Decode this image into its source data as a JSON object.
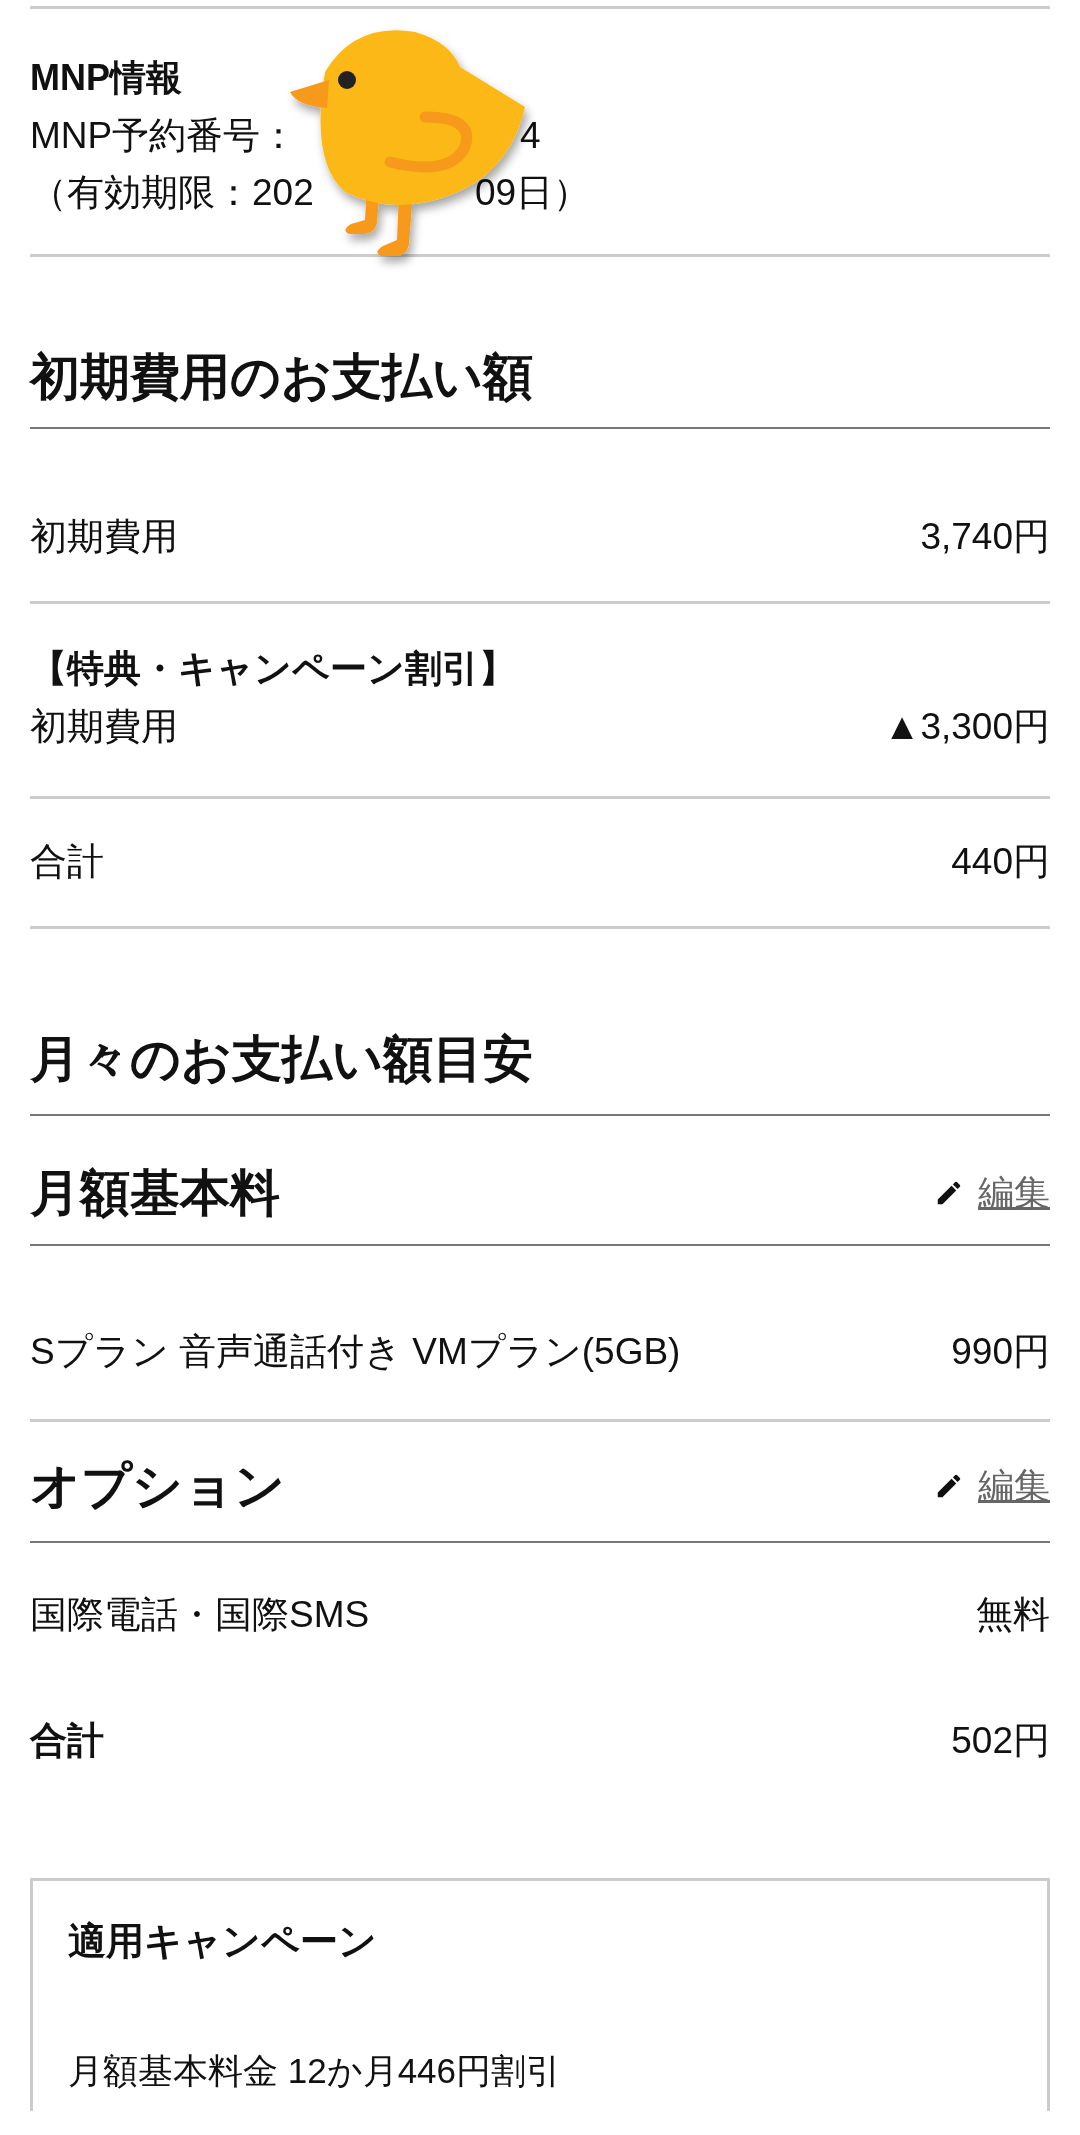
{
  "mnp": {
    "title": "MNP情報",
    "number_label": "MNP予約番号：",
    "number_tail": "4",
    "expiry_head": "（有効期限：202",
    "expiry_tail": "09日）"
  },
  "initial": {
    "title": "初期費用のお支払い額",
    "rows": [
      {
        "kind": "row",
        "label": "初期費用",
        "amount": "3,740円"
      },
      {
        "kind": "discount",
        "note": "【特典・キャンペーン割引】",
        "label": "初期費用",
        "amount": "▲3,300円"
      },
      {
        "kind": "row",
        "label": "合計",
        "amount": "440円"
      }
    ]
  },
  "monthly": {
    "title": "月々のお支払い額目安",
    "groups": [
      {
        "title": "月額基本料",
        "edit": "編集",
        "rows": [
          {
            "label": "Sプラン 音声通話付き VMプラン(5GB)",
            "amount": "990円"
          }
        ]
      },
      {
        "title": "オプション",
        "edit": "編集",
        "rows": [
          {
            "label": "国際電話・国際SMS",
            "amount": "無料"
          }
        ]
      }
    ],
    "total": {
      "label": "合計",
      "amount": "502円"
    }
  },
  "campaign": {
    "title": "適用キャンペーン",
    "items": [
      "月額基本料金 12か月446円割引"
    ]
  }
}
